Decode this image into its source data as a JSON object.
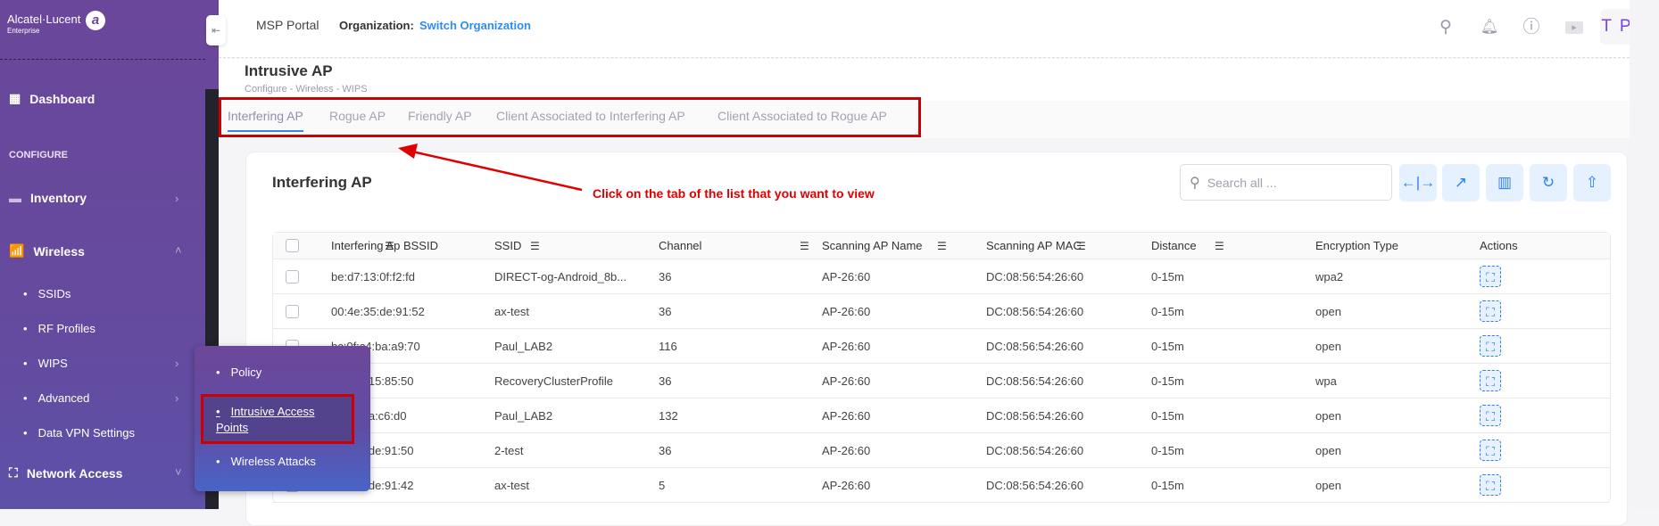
{
  "brand": {
    "name": "Alcatel·Lucent",
    "sub": "Enterprise"
  },
  "header": {
    "portal": "MSP Portal",
    "org_label": "Organization:",
    "org_link": "Switch Organization",
    "avatar": "T P",
    "icons": [
      "search-icon",
      "bell-icon",
      "help-icon",
      "video-icon"
    ]
  },
  "sidebar": {
    "dashboard": "Dashboard",
    "section": "CONFIGURE",
    "inventory": "Inventory",
    "wireless": "Wireless",
    "wireless_items": [
      "SSIDs",
      "RF Profiles",
      "WIPS",
      "Advanced",
      "Data VPN Settings"
    ],
    "network_access": "Network Access"
  },
  "popup": {
    "items": [
      "Policy",
      "Intrusive Access Points",
      "Wireless Attacks"
    ],
    "active": "Intrusive Access Points"
  },
  "page": {
    "title": "Intrusive AP",
    "breadcrumb": "Configure  -  Wireless  -  WIPS"
  },
  "tabs": [
    "Interfering AP",
    "Rogue AP",
    "Friendly AP",
    "Client Associated to Interfering AP",
    "Client Associated to Rogue AP"
  ],
  "annotation": "Click on the tab of the list that you want to view",
  "card": {
    "title": "Interfering AP",
    "search_placeholder": "Search all ...",
    "toolbar": [
      "column-resize-icon",
      "open-external-icon",
      "columns-icon",
      "refresh-icon",
      "export-icon"
    ]
  },
  "table": {
    "columns": [
      "Interfering Ap BSSID",
      "SSID",
      "Channel",
      "Scanning AP Name",
      "Scanning AP MAC",
      "Distance",
      "Encryption Type",
      "Actions"
    ],
    "rows": [
      [
        "be:d7:13:0f:f2:fd",
        "DIRECT-og-Android_8b...",
        "36",
        "AP-26:60",
        "DC:08:56:54:26:60",
        "0-15m",
        "wpa2"
      ],
      [
        "00:4e:35:de:91:52",
        "ax-test",
        "36",
        "AP-26:60",
        "DC:08:56:54:26:60",
        "0-15m",
        "open"
      ],
      [
        "bc:0f:c4:ba:a9:70",
        "Paul_LAB2",
        "116",
        "AP-26:60",
        "DC:08:56:54:26:60",
        "0-15m",
        "open"
      ],
      [
        "8:15:85:50",
        "RecoveryClusterProfile",
        "36",
        "AP-26:60",
        "DC:08:56:54:26:60",
        "0-15m",
        "wpa"
      ],
      [
        ":ba:c6:d0",
        "Paul_LAB2",
        "132",
        "AP-26:60",
        "DC:08:56:54:26:60",
        "0-15m",
        "open"
      ],
      [
        "5:de:91:50",
        "2-test",
        "36",
        "AP-26:60",
        "DC:08:56:54:26:60",
        "0-15m",
        "open"
      ],
      [
        "5:de:91:42",
        "ax-test",
        "5",
        "AP-26:60",
        "DC:08:56:54:26:60",
        "0-15m",
        "open"
      ]
    ]
  },
  "colors": {
    "sidebar": "#6a479a",
    "accent": "#2f80ed",
    "annotation": "#e00000",
    "avatar": "#7b3fe4"
  }
}
